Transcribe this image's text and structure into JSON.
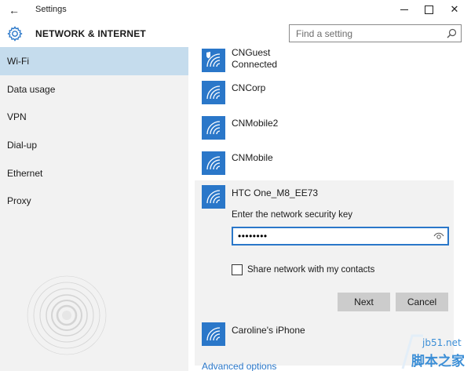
{
  "window": {
    "title": "Settings",
    "back_glyph": "←",
    "minimize_icon": "minimize-icon",
    "maximize_icon": "maximize-icon",
    "close_glyph": "✕"
  },
  "header": {
    "icon": "gear-icon",
    "title": "NETWORK & INTERNET",
    "search_placeholder": "Find a setting",
    "search_icon": "search-icon"
  },
  "sidebar": {
    "items": [
      {
        "label": "Wi-Fi",
        "selected": true
      },
      {
        "label": "Data usage",
        "selected": false
      },
      {
        "label": "VPN",
        "selected": false
      },
      {
        "label": "Dial-up",
        "selected": false
      },
      {
        "label": "Ethernet",
        "selected": false
      },
      {
        "label": "Proxy",
        "selected": false
      }
    ]
  },
  "networks": [
    {
      "name": "CNGuest",
      "status": "Connected",
      "icon": "wifi-shield-icon"
    },
    {
      "name": "CNCorp",
      "icon": "wifi-icon"
    },
    {
      "name": "CNMobile2",
      "icon": "wifi-icon"
    },
    {
      "name": "CNMobile",
      "icon": "wifi-icon"
    },
    {
      "name": "HTC One_M8_EE73",
      "icon": "wifi-icon",
      "expanded": true
    },
    {
      "name": "Caroline's iPhone",
      "icon": "wifi-icon"
    }
  ],
  "connect_panel": {
    "key_label": "Enter the network security key",
    "key_value": "••••••••",
    "reveal_icon": "eye-icon",
    "share_label": "Share network with my contacts",
    "share_checked": false,
    "next_label": "Next",
    "cancel_label": "Cancel"
  },
  "advanced_link": "Advanced options",
  "watermark": {
    "url": "jb51.net",
    "text": "脚本之家"
  },
  "colors": {
    "accent": "#2a77c9",
    "sidebar_bg": "#f2f2f2",
    "selected_bg": "#c5dced",
    "button_bg": "#cccccc"
  }
}
